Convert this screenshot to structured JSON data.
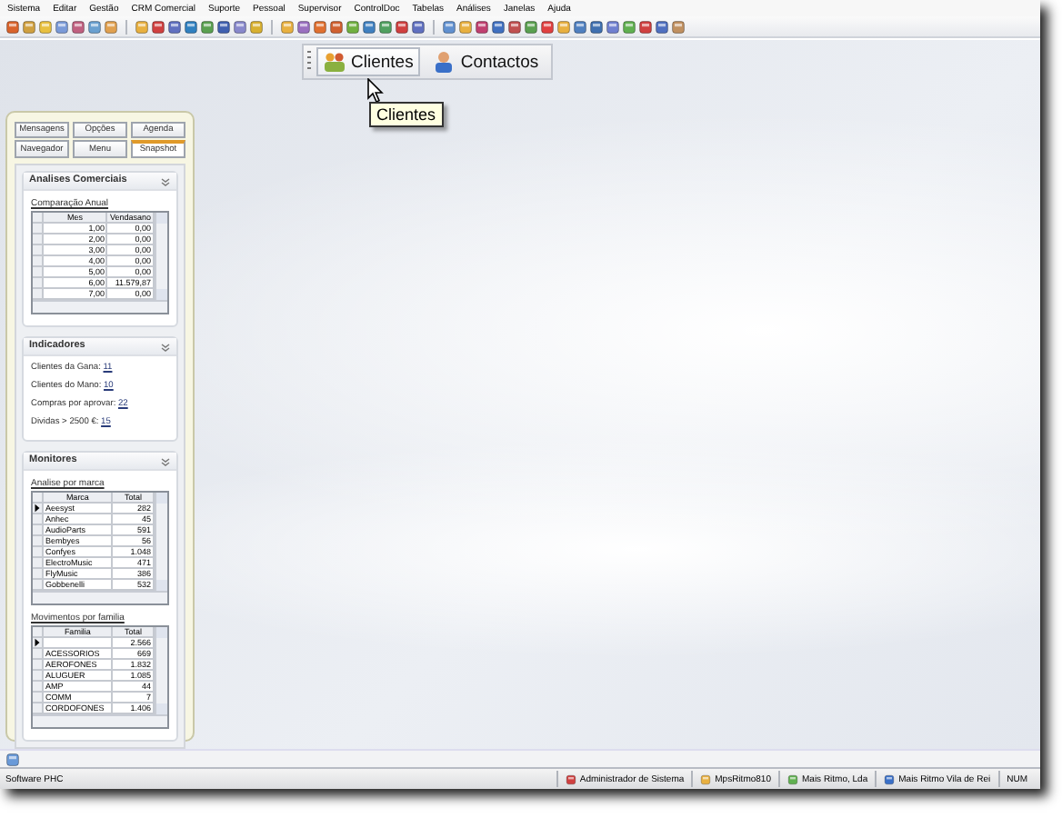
{
  "menu": [
    "Sistema",
    "Editar",
    "Gestão",
    "CRM Comercial",
    "Suporte",
    "Pessoal",
    "Supervisor",
    "ControlDoc",
    "Tabelas",
    "Análises",
    "Janelas",
    "Ajuda"
  ],
  "floating_toolbar": {
    "buttons": [
      {
        "label": "Clientes",
        "selected": true
      },
      {
        "label": "Contactos",
        "selected": false
      }
    ]
  },
  "tooltip": "Clientes",
  "side_panel": {
    "tab_rows": [
      [
        {
          "label": "Mensagens",
          "selected": false
        },
        {
          "label": "Opções",
          "selected": false
        },
        {
          "label": "Agenda",
          "selected": false
        }
      ],
      [
        {
          "label": "Navegador",
          "selected": false
        },
        {
          "label": "Menu",
          "selected": false
        },
        {
          "label": "Snapshot",
          "selected": true
        }
      ]
    ],
    "sections": [
      {
        "kind": "grids",
        "title": "Analises Comerciais",
        "grids": [
          {
            "caption": "Comparação Anual",
            "columns": [
              "Mes",
              "Vendasano"
            ],
            "rows": [
              {
                "cells": [
                  "1,00",
                  "0,00"
                ],
                "current": false
              },
              {
                "cells": [
                  "2,00",
                  "0,00"
                ],
                "current": false
              },
              {
                "cells": [
                  "3,00",
                  "0,00"
                ],
                "current": false
              },
              {
                "cells": [
                  "4,00",
                  "0,00"
                ],
                "current": false
              },
              {
                "cells": [
                  "5,00",
                  "0,00"
                ],
                "current": false
              },
              {
                "cells": [
                  "6,00",
                  "11.579,87"
                ],
                "current": false
              },
              {
                "cells": [
                  "7,00",
                  "0,00"
                ],
                "current": false
              }
            ]
          }
        ]
      },
      {
        "kind": "indicators",
        "title": "Indicadores",
        "items": [
          {
            "label": "Clientes da Gana:",
            "value": "11"
          },
          {
            "label": "Clientes do Mano:",
            "value": "10"
          },
          {
            "label": "Compras por aprovar:",
            "value": "22"
          },
          {
            "label": "Dividas > 2500 €:",
            "value": "15"
          }
        ]
      },
      {
        "kind": "grids",
        "title": "Monitores",
        "grids": [
          {
            "caption": "Analise por marca",
            "columns": [
              "Marca",
              "Total"
            ],
            "rows": [
              {
                "cells": [
                  "Aeesyst",
                  "282"
                ],
                "current": true
              },
              {
                "cells": [
                  "Anhec",
                  "45"
                ],
                "current": false
              },
              {
                "cells": [
                  "AudioParts",
                  "591"
                ],
                "current": false
              },
              {
                "cells": [
                  "Bembyes",
                  "56"
                ],
                "current": false
              },
              {
                "cells": [
                  "Confyes",
                  "1.048"
                ],
                "current": false
              },
              {
                "cells": [
                  "ElectroMusic",
                  "471"
                ],
                "current": false
              },
              {
                "cells": [
                  "FlyMusic",
                  "386"
                ],
                "current": false
              },
              {
                "cells": [
                  "Gobbenelli",
                  "532"
                ],
                "current": false
              }
            ]
          },
          {
            "caption": "Movimentos por familia",
            "columns": [
              "Familia",
              "Total"
            ],
            "rows": [
              {
                "cells": [
                  "",
                  "2.566"
                ],
                "current": true
              },
              {
                "cells": [
                  "ACESSORIOS",
                  "669"
                ],
                "current": false
              },
              {
                "cells": [
                  "AEROFONES",
                  "1.832"
                ],
                "current": false
              },
              {
                "cells": [
                  "ALUGUER",
                  "1.085"
                ],
                "current": false
              },
              {
                "cells": [
                  "AMP",
                  "44"
                ],
                "current": false
              },
              {
                "cells": [
                  "COMM",
                  "7"
                ],
                "current": false
              },
              {
                "cells": [
                  "CORDOFONES",
                  "1.406"
                ],
                "current": false
              }
            ]
          }
        ]
      }
    ]
  },
  "status_bar": {
    "text": "Software PHC",
    "panels": [
      "Administrador de Sistema",
      "MpsRitmo810",
      "Mais Ritmo, Lda",
      "Mais Ritmo Vila de Rei",
      "NUM"
    ]
  }
}
